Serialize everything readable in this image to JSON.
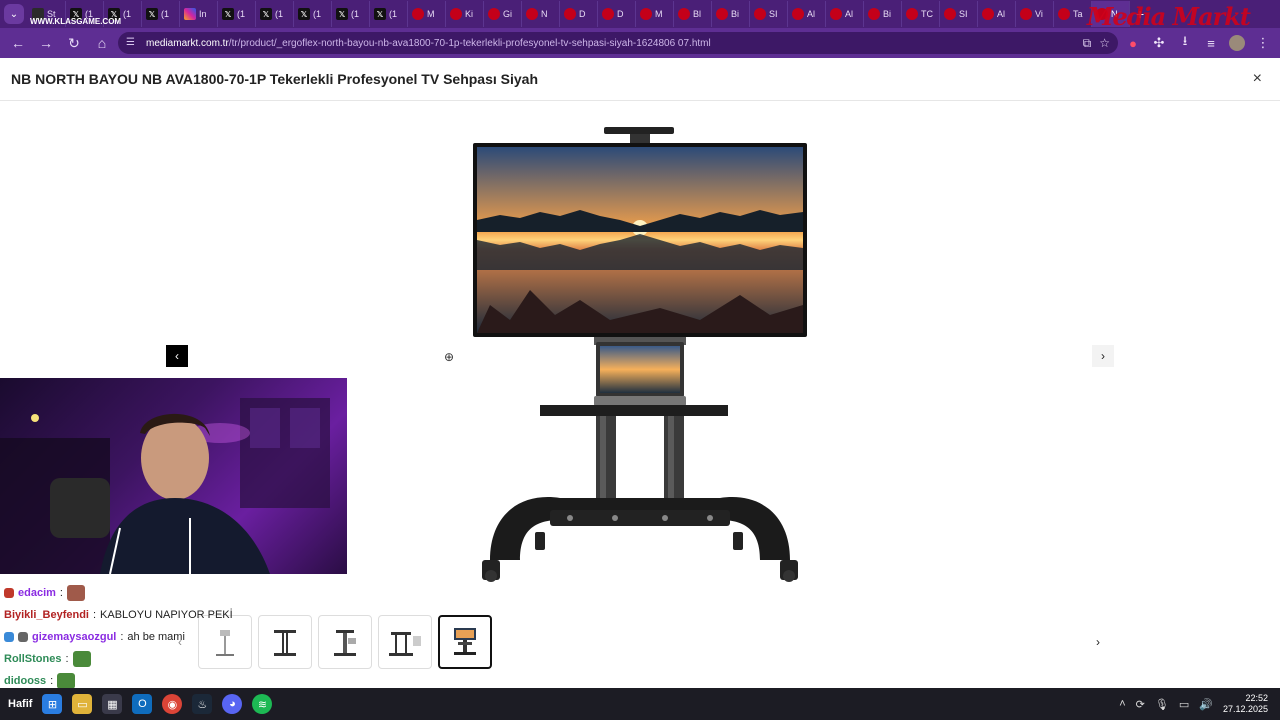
{
  "browser": {
    "tabs": [
      {
        "label": "St",
        "icon": "fav-gen"
      },
      {
        "label": "(1",
        "icon": "x-icon"
      },
      {
        "label": "(1",
        "icon": "x-icon"
      },
      {
        "label": "(1",
        "icon": "x-icon"
      },
      {
        "label": "In",
        "icon": "instagram-icon"
      },
      {
        "label": "(1",
        "icon": "x-icon"
      },
      {
        "label": "(1",
        "icon": "x-icon"
      },
      {
        "label": "(1",
        "icon": "x-icon"
      },
      {
        "label": "(1",
        "icon": "x-icon"
      },
      {
        "label": "(1",
        "icon": "x-icon"
      },
      {
        "label": "M",
        "icon": "mediamarkt-icon"
      },
      {
        "label": "Ki",
        "icon": "mediamarkt-icon"
      },
      {
        "label": "Gi",
        "icon": "mediamarkt-icon"
      },
      {
        "label": "N",
        "icon": "mediamarkt-icon"
      },
      {
        "label": "D",
        "icon": "mediamarkt-icon"
      },
      {
        "label": "D",
        "icon": "mediamarkt-icon"
      },
      {
        "label": "M",
        "icon": "mediamarkt-icon"
      },
      {
        "label": "Bl",
        "icon": "mediamarkt-icon"
      },
      {
        "label": "Bi",
        "icon": "mediamarkt-icon"
      },
      {
        "label": "SI",
        "icon": "mediamarkt-icon"
      },
      {
        "label": "Al",
        "icon": "mediamarkt-icon"
      },
      {
        "label": "Al",
        "icon": "mediamarkt-icon"
      },
      {
        "label": "Bi",
        "icon": "mediamarkt-icon"
      },
      {
        "label": "TC",
        "icon": "mediamarkt-icon"
      },
      {
        "label": "SI",
        "icon": "mediamarkt-icon"
      },
      {
        "label": "Al",
        "icon": "mediamarkt-icon"
      },
      {
        "label": "Vi",
        "icon": "mediamarkt-icon"
      },
      {
        "label": "Ta",
        "icon": "mediamarkt-icon"
      },
      {
        "label": "N",
        "icon": "mediamarkt-icon",
        "active": true
      }
    ],
    "new_tab": "+",
    "url_domain": "mediamarkt.com.tr",
    "url_path": "/tr/product/_ergoflex-north-bayou-nb-ava1800-70-1p-tekerlekli-profesyonel-tv-sehpasi-siyah-1624806 07.html",
    "watermark": "WWW.KLASGAME.COM",
    "brand_logo": "Media Markt"
  },
  "product": {
    "title": "NB NORTH BAYOU NB AVA1800-70-1P Tekerlekli Profesyonel TV Sehpası Siyah",
    "close": "×",
    "prev": "‹",
    "next": "›",
    "thumbnail_count": 5,
    "active_thumbnail": 5
  },
  "chat": [
    {
      "user": "edacim",
      "sep": " :",
      "msg": "",
      "color": "#8a2be2"
    },
    {
      "user": "Biyikli_Beyfendi",
      "sep": " :",
      "msg": "KABLOYU NAPIYOR PEKİ",
      "color": "#b22222"
    },
    {
      "user": "gizemaysaozgul",
      "sep": " :",
      "msg": "ah be mami",
      "color": "#8a2be2"
    },
    {
      "user": "RollStones",
      "sep": " :",
      "msg": "",
      "color": "#2e8b57"
    },
    {
      "user": "didooss",
      "sep": " :",
      "msg": "",
      "color": "#2e8b57"
    }
  ],
  "taskbar": {
    "weather": "Hafif",
    "time": "22:52",
    "date": "27.12.2025"
  },
  "colors": {
    "chrome_dark": "#4a1f77",
    "chrome": "#5e2e93",
    "brand_red": "#d0021b"
  }
}
